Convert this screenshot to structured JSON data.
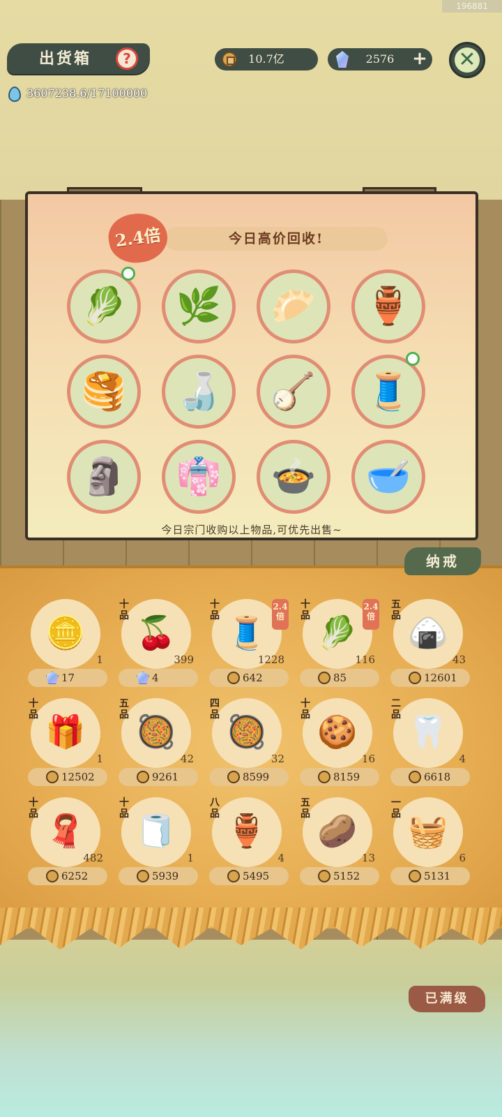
{
  "build_id": "196881",
  "header": {
    "title": "出货箱",
    "help_icon": "question-icon",
    "coins": "10.7亿",
    "gems": "2576",
    "water": "3607238.6/17100000"
  },
  "board": {
    "multiplier": "2.4倍",
    "banner": "今日高价回收!",
    "note": "今日宗门收购以上物品,可优先出售~",
    "items": [
      {
        "name": "radish",
        "glyph": "🥬",
        "new": true
      },
      {
        "name": "herb-leaves",
        "glyph": "🌿",
        "new": false
      },
      {
        "name": "buns",
        "glyph": "🥟",
        "new": false
      },
      {
        "name": "clay-jar",
        "glyph": "🏺",
        "new": false
      },
      {
        "name": "pancake",
        "glyph": "🥞",
        "new": false
      },
      {
        "name": "gourd-bottle",
        "glyph": "🍶",
        "new": false
      },
      {
        "name": "pipa",
        "glyph": "🪕",
        "new": false
      },
      {
        "name": "thread-spool",
        "glyph": "🧵",
        "new": true
      },
      {
        "name": "figurine",
        "glyph": "🗿",
        "new": false
      },
      {
        "name": "robe",
        "glyph": "👘",
        "new": false
      },
      {
        "name": "fish-dish",
        "glyph": "🍲",
        "new": false
      },
      {
        "name": "sausage-bowl",
        "glyph": "🥣",
        "new": false
      }
    ]
  },
  "inventory": {
    "ring_label": "纳戒",
    "items": [
      {
        "grade": "",
        "mult": "",
        "qty": "1",
        "price": "17",
        "currency": "gem",
        "glyph": "🪙"
      },
      {
        "grade": "十品",
        "mult": "",
        "qty": "399",
        "price": "4",
        "currency": "gem",
        "glyph": "🍒"
      },
      {
        "grade": "十品",
        "mult": "2.4倍",
        "qty": "1228",
        "price": "642",
        "currency": "coin",
        "glyph": "🧵"
      },
      {
        "grade": "十品",
        "mult": "2.4倍",
        "qty": "116",
        "price": "85",
        "currency": "coin",
        "glyph": "🥬"
      },
      {
        "grade": "五品",
        "mult": "",
        "qty": "43",
        "price": "12601",
        "currency": "coin",
        "glyph": "🍙"
      },
      {
        "grade": "十品",
        "mult": "",
        "qty": "1",
        "price": "12502",
        "currency": "coin",
        "glyph": "🎁"
      },
      {
        "grade": "五品",
        "mult": "",
        "qty": "42",
        "price": "9261",
        "currency": "coin",
        "glyph": "🥘"
      },
      {
        "grade": "四品",
        "mult": "",
        "qty": "32",
        "price": "8599",
        "currency": "coin",
        "glyph": "🥘"
      },
      {
        "grade": "十品",
        "mult": "",
        "qty": "16",
        "price": "8159",
        "currency": "coin",
        "glyph": "🍪"
      },
      {
        "grade": "二品",
        "mult": "",
        "qty": "4",
        "price": "6618",
        "currency": "coin",
        "glyph": "🦷"
      },
      {
        "grade": "十品",
        "mult": "",
        "qty": "482",
        "price": "6252",
        "currency": "coin",
        "glyph": "🧣"
      },
      {
        "grade": "十品",
        "mult": "",
        "qty": "1",
        "price": "5939",
        "currency": "coin",
        "glyph": "🧻"
      },
      {
        "grade": "八品",
        "mult": "",
        "qty": "4",
        "price": "5495",
        "currency": "coin",
        "glyph": "🏺"
      },
      {
        "grade": "五品",
        "mult": "",
        "qty": "13",
        "price": "5152",
        "currency": "coin",
        "glyph": "🥔"
      },
      {
        "grade": "一品",
        "mult": "",
        "qty": "6",
        "price": "5131",
        "currency": "coin",
        "glyph": "🧺"
      }
    ]
  },
  "maxed_label": "已满级"
}
